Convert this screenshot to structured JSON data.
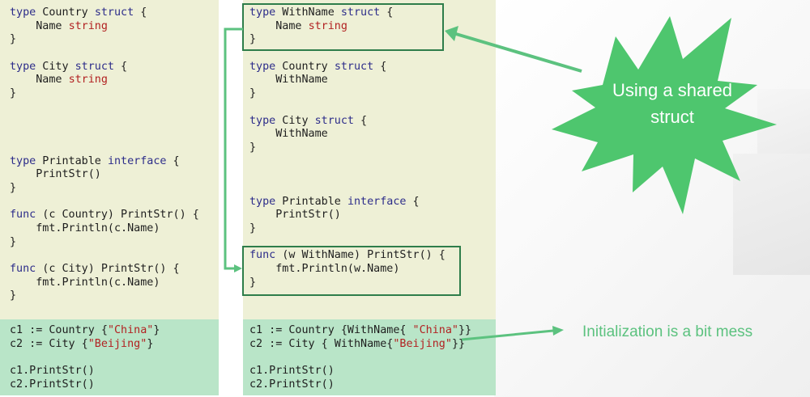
{
  "colors": {
    "code_bg": "#eef0d6",
    "usage_bg": "#b9e5c8",
    "box_border": "#2e7d4a",
    "arrow": "#5cc27f",
    "starburst": "#4ec66e",
    "keyword": "#2d2d8a",
    "type": "#b22222",
    "string": "#b22222"
  },
  "left": {
    "decls": [
      [
        {
          "t": "type",
          "c": "kw"
        },
        {
          "t": " Country "
        },
        {
          "t": "struct",
          "c": "kw"
        },
        {
          "t": " {"
        }
      ],
      [
        {
          "t": "    Name "
        },
        {
          "t": "string",
          "c": "ty"
        }
      ],
      [
        {
          "t": "}"
        }
      ],
      [],
      [
        {
          "t": "type",
          "c": "kw"
        },
        {
          "t": " City "
        },
        {
          "t": "struct",
          "c": "kw"
        },
        {
          "t": " {"
        }
      ],
      [
        {
          "t": "    Name "
        },
        {
          "t": "string",
          "c": "ty"
        }
      ],
      [
        {
          "t": "}"
        }
      ],
      [],
      [],
      [],
      [],
      [
        {
          "t": "type",
          "c": "kw"
        },
        {
          "t": " Printable "
        },
        {
          "t": "interface",
          "c": "kw"
        },
        {
          "t": " {"
        }
      ],
      [
        {
          "t": "    PrintStr()"
        }
      ],
      [
        {
          "t": "}"
        }
      ],
      [],
      [
        {
          "t": "func",
          "c": "kw"
        },
        {
          "t": " (c Country) PrintStr() {"
        }
      ],
      [
        {
          "t": "    fmt.Println(c.Name)"
        }
      ],
      [
        {
          "t": "}"
        }
      ],
      [],
      [
        {
          "t": "func",
          "c": "kw"
        },
        {
          "t": " (c City) PrintStr() {"
        }
      ],
      [
        {
          "t": "    fmt.Println(c.Name)"
        }
      ],
      [
        {
          "t": "}"
        }
      ]
    ],
    "usage": [
      [
        {
          "t": "c1 := Country {"
        },
        {
          "t": "\"China\"",
          "c": "st"
        },
        {
          "t": "}"
        }
      ],
      [
        {
          "t": "c2 := City {"
        },
        {
          "t": "\"Beijing\"",
          "c": "st"
        },
        {
          "t": "}"
        }
      ],
      [],
      [
        {
          "t": "c1.PrintStr()"
        }
      ],
      [
        {
          "t": "c2.PrintStr()"
        }
      ]
    ]
  },
  "right": {
    "decls": [
      [
        {
          "t": "type",
          "c": "kw"
        },
        {
          "t": " WithName "
        },
        {
          "t": "struct",
          "c": "kw"
        },
        {
          "t": " {"
        }
      ],
      [
        {
          "t": "    Name "
        },
        {
          "t": "string",
          "c": "ty"
        }
      ],
      [
        {
          "t": "}"
        }
      ],
      [],
      [
        {
          "t": "type",
          "c": "kw"
        },
        {
          "t": " Country "
        },
        {
          "t": "struct",
          "c": "kw"
        },
        {
          "t": " {"
        }
      ],
      [
        {
          "t": "    WithName"
        }
      ],
      [
        {
          "t": "}"
        }
      ],
      [],
      [
        {
          "t": "type",
          "c": "kw"
        },
        {
          "t": " City "
        },
        {
          "t": "struct",
          "c": "kw"
        },
        {
          "t": " {"
        }
      ],
      [
        {
          "t": "    WithName"
        }
      ],
      [
        {
          "t": "}"
        }
      ],
      [],
      [],
      [],
      [
        {
          "t": "type",
          "c": "kw"
        },
        {
          "t": " Printable "
        },
        {
          "t": "interface",
          "c": "kw"
        },
        {
          "t": " {"
        }
      ],
      [
        {
          "t": "    PrintStr()"
        }
      ],
      [
        {
          "t": "}"
        }
      ],
      [],
      [
        {
          "t": "func",
          "c": "kw"
        },
        {
          "t": " (w WithName) PrintStr() {"
        }
      ],
      [
        {
          "t": "    fmt.Println(w.Name)"
        }
      ],
      [
        {
          "t": "}"
        }
      ]
    ],
    "usage": [
      [
        {
          "t": "c1 := Country {WithName{ "
        },
        {
          "t": "\"China\"",
          "c": "st"
        },
        {
          "t": "}}"
        }
      ],
      [
        {
          "t": "c2 := City { WithName{"
        },
        {
          "t": "\"Beijing\"",
          "c": "st"
        },
        {
          "t": "}}"
        }
      ],
      [],
      [
        {
          "t": "c1.PrintStr()"
        }
      ],
      [
        {
          "t": "c2.PrintStr()"
        }
      ]
    ]
  },
  "annotations": {
    "callout": "Using a shared struct",
    "note": "Initialization is a bit mess"
  }
}
